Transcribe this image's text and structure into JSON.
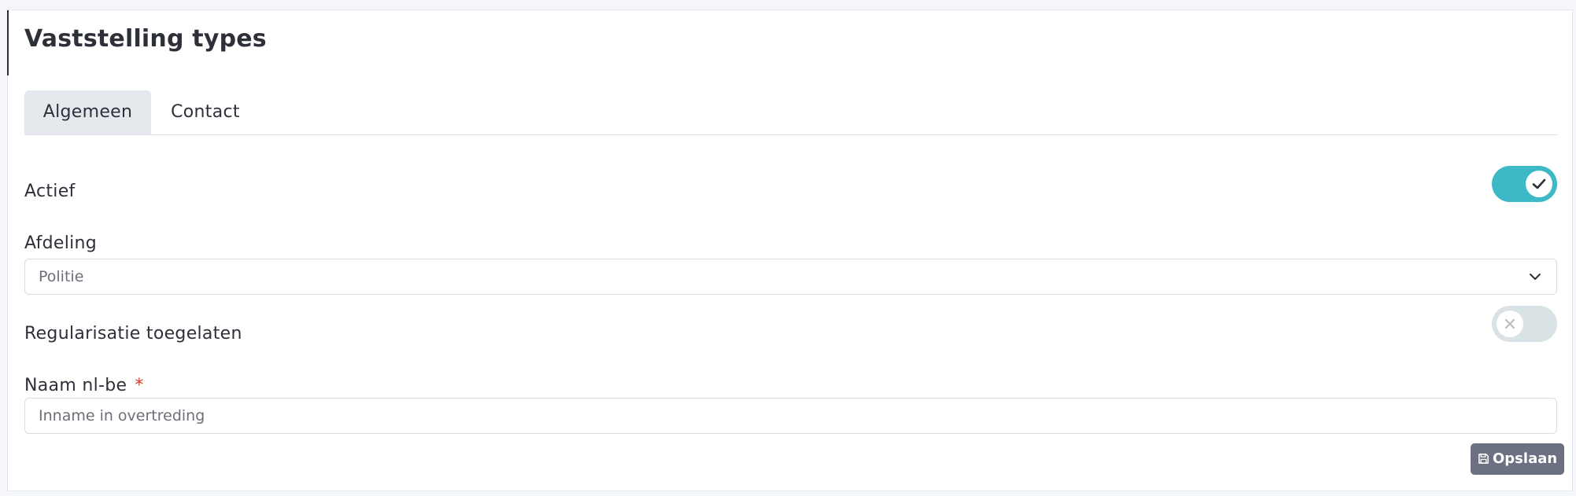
{
  "page": {
    "title": "Vaststelling types"
  },
  "tabs": [
    {
      "label": "Algemeen",
      "active": true
    },
    {
      "label": "Contact",
      "active": false
    }
  ],
  "form": {
    "actief": {
      "label": "Actief",
      "value": true
    },
    "afdeling": {
      "label": "Afdeling",
      "selected": "Politie"
    },
    "regularisatie": {
      "label": "Regularisatie toegelaten",
      "value": false
    },
    "naam": {
      "label": "Naam nl-be",
      "required_mark": "*",
      "value": "Inname in overtreding"
    }
  },
  "actions": {
    "save_label": "Opslaan"
  },
  "colors": {
    "toggle_on": "#3db8c6",
    "toggle_off": "#d9e2e5",
    "active_tab": "#e5e8ec",
    "save_button": "#6b7083",
    "required": "#d63a2b"
  },
  "icons": {
    "check": "check-icon",
    "close": "close-icon",
    "chevron": "chevron-down-icon",
    "save": "floppy-disk-icon"
  }
}
